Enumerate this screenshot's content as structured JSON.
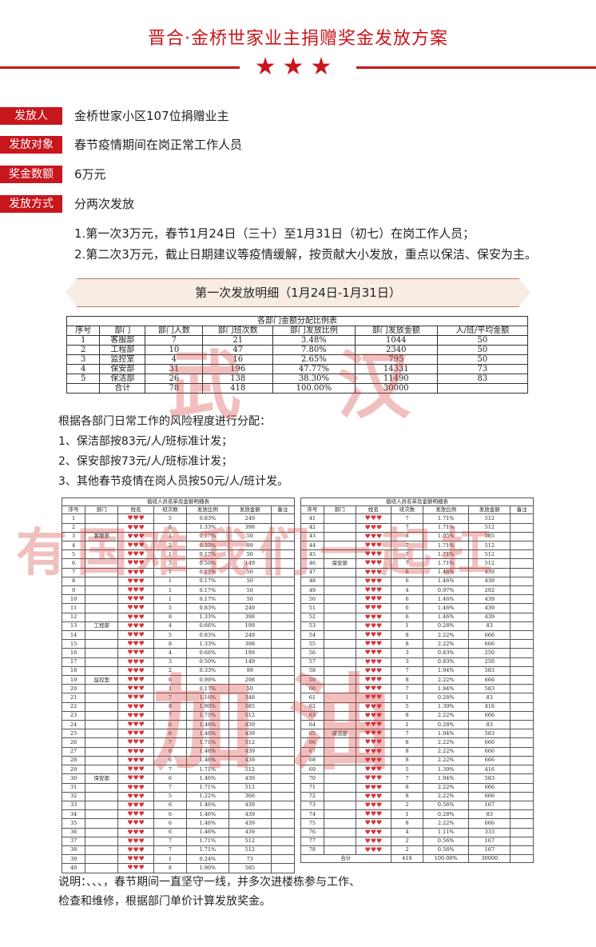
{
  "title": "晋合·金桥世家业主捐赠奖金发放方案",
  "info": [
    {
      "label": "发放人",
      "value": "金桥世家小区107位捐赠业主"
    },
    {
      "label": "发放对象",
      "value": "春节疫情期间在岗正常工作人员"
    },
    {
      "label": "奖金数额",
      "value": "6万元"
    },
    {
      "label": "发放方式",
      "value": "分两次发放"
    }
  ],
  "plan_lines": [
    "1.第一次3万元，春节1月24日（三十）至1月31日（初七）在岗工作人员；",
    "2.第二次3万元，截止日期建议等疫情缓解，按贡献大小发放，重点以保洁、保安为主。"
  ],
  "banner": "第一次发放明细（1月24日-1月31日）",
  "dept_table": {
    "caption": "各部门金额分配比例表",
    "headers": [
      "序号",
      "部门",
      "部门人数",
      "部门班次数",
      "部门发放比例",
      "部门发放金额",
      "人/班/平均金额"
    ],
    "rows": [
      [
        "1",
        "客服部",
        "7",
        "21",
        "3.48%",
        "1044",
        "50"
      ],
      [
        "2",
        "工程部",
        "10",
        "47",
        "7.80%",
        "2340",
        "50"
      ],
      [
        "3",
        "监控室",
        "4",
        "16",
        "2.65%",
        "795",
        "50"
      ],
      [
        "4",
        "保安部",
        "31",
        "196",
        "47.77%",
        "14331",
        "73"
      ],
      [
        "5",
        "保洁部",
        "26",
        "138",
        "38.30%",
        "11490",
        "83"
      ]
    ],
    "total": [
      "",
      "合计",
      "78",
      "418",
      "100.00%",
      "30000",
      ""
    ]
  },
  "rules": [
    "根据各部门日常工作的风险程度进行分配：",
    "1、保洁部按83元/人/班标准计发；",
    "2、保安部按73元/人/班标准计发；",
    "3、其他春节疫情在岗人员按50元/人/班计发。"
  ],
  "detail": {
    "caption": "值班人员名单及金额明细表",
    "headers": [
      "序号",
      "部门",
      "姓名",
      "班次数",
      "发放比例",
      "发放金额",
      "备注"
    ],
    "left_rows": [
      [
        "1",
        "",
        "5",
        "0.83%",
        "249"
      ],
      [
        "2",
        "",
        "8",
        "1.33%",
        "398"
      ],
      [
        "3",
        "客服部",
        "1",
        "0.17%",
        "50"
      ],
      [
        "4",
        "",
        "2",
        "0.33%",
        "99"
      ],
      [
        "5",
        "",
        "1",
        "0.17%",
        "50"
      ],
      [
        "6",
        "",
        "3",
        "0.50%",
        "149"
      ],
      [
        "7",
        "",
        "1",
        "0.17%",
        "50"
      ],
      [
        "8",
        "",
        "1",
        "0.17%",
        "50"
      ],
      [
        "9",
        "",
        "1",
        "0.17%",
        "50"
      ],
      [
        "10",
        "",
        "1",
        "0.17%",
        "50"
      ],
      [
        "11",
        "",
        "5",
        "0.83%",
        "249"
      ],
      [
        "12",
        "",
        "8",
        "1.33%",
        "398"
      ],
      [
        "13",
        "工程部",
        "4",
        "0.66%",
        "199"
      ],
      [
        "14",
        "",
        "5",
        "0.83%",
        "249"
      ],
      [
        "15",
        "",
        "8",
        "1.33%",
        "398"
      ],
      [
        "16",
        "",
        "4",
        "0.66%",
        "199"
      ],
      [
        "17",
        "",
        "3",
        "0.50%",
        "149"
      ],
      [
        "18",
        "",
        "2",
        "0.33%",
        "99"
      ],
      [
        "19",
        "监控室",
        "6",
        "0.99%",
        "298"
      ],
      [
        "20",
        "",
        "1",
        "0.17%",
        "50"
      ],
      [
        "21",
        "",
        "7",
        "1.16%",
        "348"
      ],
      [
        "22",
        "",
        "8",
        "1.90%",
        "585"
      ],
      [
        "23",
        "",
        "7",
        "1.71%",
        "512"
      ],
      [
        "24",
        "",
        "6",
        "1.46%",
        "439"
      ],
      [
        "25",
        "",
        "6",
        "1.46%",
        "439"
      ],
      [
        "26",
        "",
        "7",
        "1.71%",
        "512"
      ],
      [
        "27",
        "",
        "6",
        "1.46%",
        "439"
      ],
      [
        "28",
        "",
        "6",
        "1.46%",
        "439"
      ],
      [
        "29",
        "",
        "7",
        "1.71%",
        "512"
      ],
      [
        "30",
        "保安部",
        "6",
        "1.46%",
        "439"
      ],
      [
        "31",
        "",
        "7",
        "1.71%",
        "512"
      ],
      [
        "32",
        "",
        "5",
        "1.22%",
        "366"
      ],
      [
        "33",
        "",
        "6",
        "1.46%",
        "439"
      ],
      [
        "34",
        "",
        "6",
        "1.46%",
        "439"
      ],
      [
        "35",
        "",
        "6",
        "1.46%",
        "439"
      ],
      [
        "36",
        "",
        "6",
        "1.46%",
        "439"
      ],
      [
        "37",
        "",
        "7",
        "1.71%",
        "512"
      ],
      [
        "38",
        "",
        "7",
        "1.71%",
        "512"
      ],
      [
        "39",
        "",
        "1",
        "0.24%",
        "73"
      ],
      [
        "40",
        "",
        "8",
        "1.90%",
        "585"
      ]
    ],
    "right_rows": [
      [
        "41",
        "",
        "7",
        "1.71%",
        "512"
      ],
      [
        "42",
        "",
        "7",
        "1.71%",
        "512"
      ],
      [
        "43",
        "",
        "8",
        "1.95%",
        "585"
      ],
      [
        "44",
        "",
        "7",
        "1.71%",
        "512"
      ],
      [
        "45",
        "",
        "7",
        "1.71%",
        "512"
      ],
      [
        "46",
        "保安部",
        "7",
        "1.71%",
        "512"
      ],
      [
        "47",
        "",
        "6",
        "1.46%",
        "439"
      ],
      [
        "48",
        "",
        "6",
        "1.46%",
        "439"
      ],
      [
        "49",
        "",
        "4",
        "0.97%",
        "292"
      ],
      [
        "50",
        "",
        "6",
        "1.46%",
        "439"
      ],
      [
        "51",
        "",
        "6",
        "1.46%",
        "439"
      ],
      [
        "52",
        "",
        "6",
        "1.46%",
        "439"
      ],
      [
        "53",
        "",
        "1",
        "0.28%",
        "83"
      ],
      [
        "54",
        "",
        "8",
        "2.22%",
        "666"
      ],
      [
        "55",
        "",
        "8",
        "2.22%",
        "666"
      ],
      [
        "56",
        "",
        "3",
        "0.83%",
        "250"
      ],
      [
        "57",
        "",
        "3",
        "0.83%",
        "250"
      ],
      [
        "58",
        "",
        "7",
        "1.94%",
        "583"
      ],
      [
        "59",
        "",
        "8",
        "2.22%",
        "666"
      ],
      [
        "60",
        "",
        "7",
        "1.94%",
        "583"
      ],
      [
        "61",
        "",
        "1",
        "0.28%",
        "83"
      ],
      [
        "62",
        "",
        "5",
        "1.39%",
        "416"
      ],
      [
        "63",
        "",
        "8",
        "2.22%",
        "666"
      ],
      [
        "64",
        "",
        "1",
        "0.28%",
        "83"
      ],
      [
        "65",
        "保洁部",
        "7",
        "1.94%",
        "583"
      ],
      [
        "66",
        "",
        "8",
        "2.22%",
        "666"
      ],
      [
        "67",
        "",
        "8",
        "2.22%",
        "666"
      ],
      [
        "68",
        "",
        "8",
        "2.22%",
        "666"
      ],
      [
        "69",
        "",
        "5",
        "1.39%",
        "416"
      ],
      [
        "70",
        "",
        "7",
        "1.94%",
        "583"
      ],
      [
        "71",
        "",
        "8",
        "2.22%",
        "666"
      ],
      [
        "72",
        "",
        "8",
        "2.22%",
        "666"
      ],
      [
        "73",
        "",
        "2",
        "0.56%",
        "167"
      ],
      [
        "74",
        "",
        "1",
        "0.28%",
        "83"
      ],
      [
        "75",
        "",
        "8",
        "2.22%",
        "666"
      ],
      [
        "76",
        "",
        "4",
        "1.11%",
        "333"
      ],
      [
        "77",
        "",
        "2",
        "0.56%",
        "167"
      ],
      [
        "78",
        "",
        "2",
        "0.56%",
        "167"
      ]
    ],
    "total": [
      "合计",
      "418",
      "100.00%",
      "30000"
    ]
  },
  "note_lines": [
    "说明：、、、，春节期间一直坚守一线，并多次进楼栋参与工作、",
    "检查和维修，根据部门单价计算发放奖金。"
  ]
}
